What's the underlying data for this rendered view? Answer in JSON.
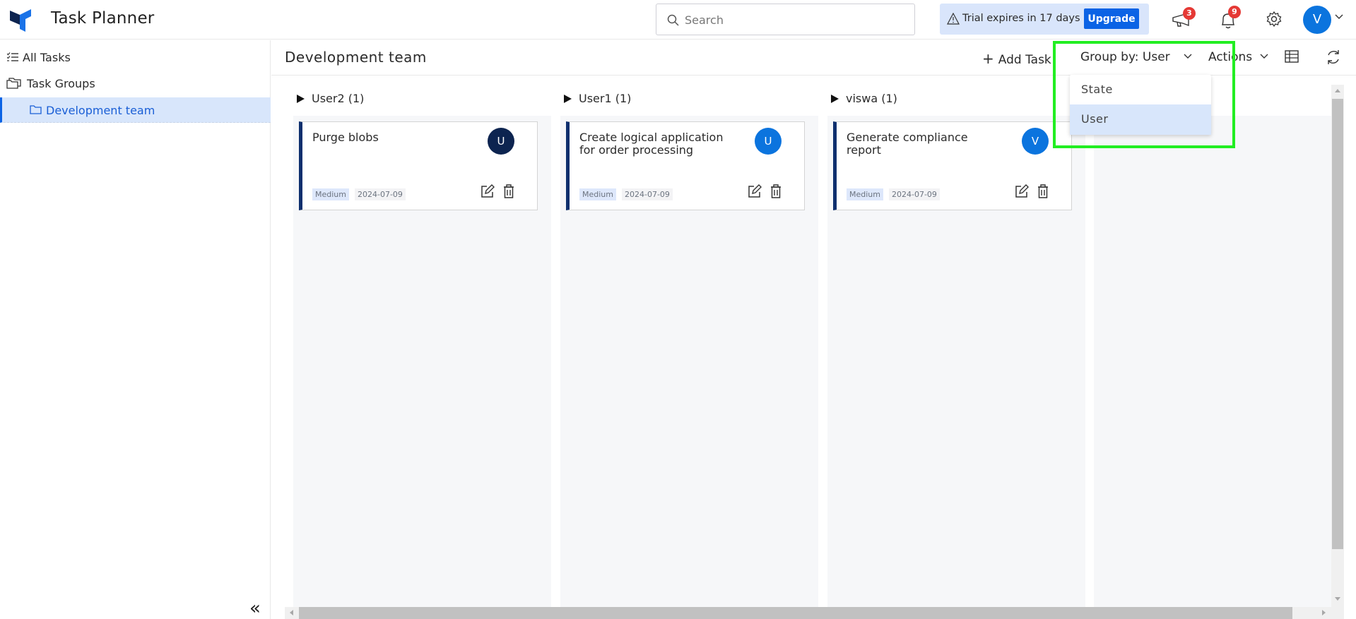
{
  "header": {
    "app_title": "Task Planner",
    "search_placeholder": "Search",
    "trial_text": "Trial expires in 17 days",
    "upgrade_label": "Upgrade",
    "announcements_count": "3",
    "notifications_count": "9",
    "user_initial": "V"
  },
  "sidebar": {
    "items": [
      {
        "label": "All Tasks",
        "icon": "checklist-icon"
      },
      {
        "label": "Task Groups",
        "icon": "folders-icon"
      },
      {
        "label": "Development team",
        "icon": "folder-icon",
        "active": true
      }
    ],
    "collapse_glyph": "«"
  },
  "toolbar": {
    "page_title": "Development team",
    "add_task_label": "Add Task",
    "group_by_label": "Group by: User",
    "actions_label": "Actions"
  },
  "group_by_menu": {
    "options": [
      "State",
      "User"
    ],
    "selected": "User"
  },
  "colors": {
    "accent": "#0b63e5",
    "selected_bg": "#d8e6fb",
    "card_border_left": "#0d2f6e",
    "badge_red": "#e53935",
    "highlight": "#22ee22"
  },
  "columns": [
    {
      "header": "User2 (1)",
      "cards": [
        {
          "title": "Purge blobs",
          "avatar": "U",
          "avatar_color": "#0d2450",
          "priority": "Medium",
          "date": "2024-07-09"
        }
      ]
    },
    {
      "header": "User1 (1)",
      "cards": [
        {
          "title": "Create logical application for order processing",
          "avatar": "U",
          "avatar_color": "#0b74de",
          "priority": "Medium",
          "date": "2024-07-09"
        }
      ]
    },
    {
      "header": "viswa (1)",
      "cards": [
        {
          "title": "Generate compliance report",
          "avatar": "V",
          "avatar_color": "#0b74de",
          "priority": "Medium",
          "date": "2024-07-09"
        }
      ]
    }
  ]
}
